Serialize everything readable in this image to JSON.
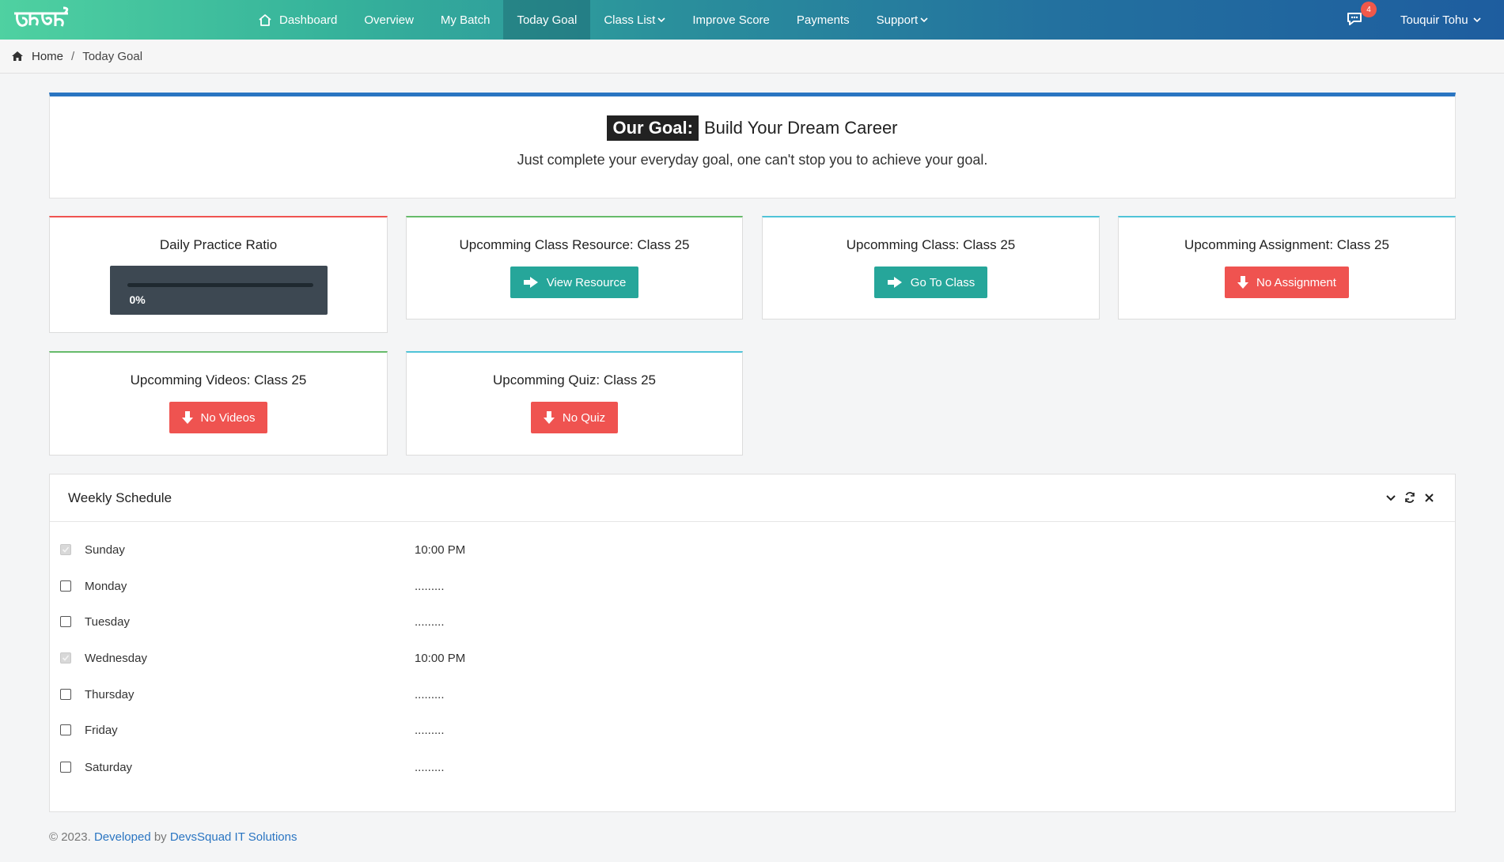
{
  "brand": {
    "logo_text": "অর্বিন্দু"
  },
  "nav": {
    "items": [
      {
        "label": "Dashboard",
        "icon": "home-icon"
      },
      {
        "label": "Overview"
      },
      {
        "label": "My Batch"
      },
      {
        "label": "Today Goal",
        "active": true
      },
      {
        "label": "Class List",
        "dropdown": true
      },
      {
        "label": "Improve Score"
      },
      {
        "label": "Payments"
      },
      {
        "label": "Support",
        "dropdown": true
      }
    ],
    "chat_badge": "4",
    "user_name": "Touquir Tohu"
  },
  "breadcrumb": {
    "home": "Home",
    "separator": "/",
    "current": "Today Goal"
  },
  "goal": {
    "tag": "Our Goal:",
    "title": "Build Your Dream Career",
    "subtitle": "Just complete your everyday goal, one can't stop you to achieve your goal."
  },
  "cards": {
    "practice": {
      "title": "Daily Practice Ratio",
      "percent_label": "0%",
      "progress": 0
    },
    "resource": {
      "title": "Upcomming Class Resource: Class 25",
      "button": "View Resource"
    },
    "class": {
      "title": "Upcomming Class: Class 25",
      "button": "Go To Class"
    },
    "assignment": {
      "title": "Upcomming Assignment: Class 25",
      "button": "No Assignment"
    },
    "videos": {
      "title": "Upcomming Videos: Class 25",
      "button": "No Videos"
    },
    "quiz": {
      "title": "Upcomming Quiz: Class 25",
      "button": "No Quiz"
    }
  },
  "schedule": {
    "title": "Weekly Schedule",
    "rows": [
      {
        "day": "Sunday",
        "time": "10:00 PM",
        "checked": true
      },
      {
        "day": "Monday",
        "time": ".........",
        "checked": false
      },
      {
        "day": "Tuesday",
        "time": ".........",
        "checked": false
      },
      {
        "day": "Wednesday",
        "time": "10:00 PM",
        "checked": true
      },
      {
        "day": "Thursday",
        "time": ".........",
        "checked": false
      },
      {
        "day": "Friday",
        "time": ".........",
        "checked": false
      },
      {
        "day": "Saturday",
        "time": ".........",
        "checked": false
      }
    ]
  },
  "footer": {
    "copyright": "© 2023.",
    "developed": "Developed",
    "by": "by",
    "company": "DevsSquad IT Solutions"
  },
  "colors": {
    "accent_teal": "#26a69a",
    "accent_red": "#ef5350",
    "accent_blue": "#2a75c2"
  }
}
